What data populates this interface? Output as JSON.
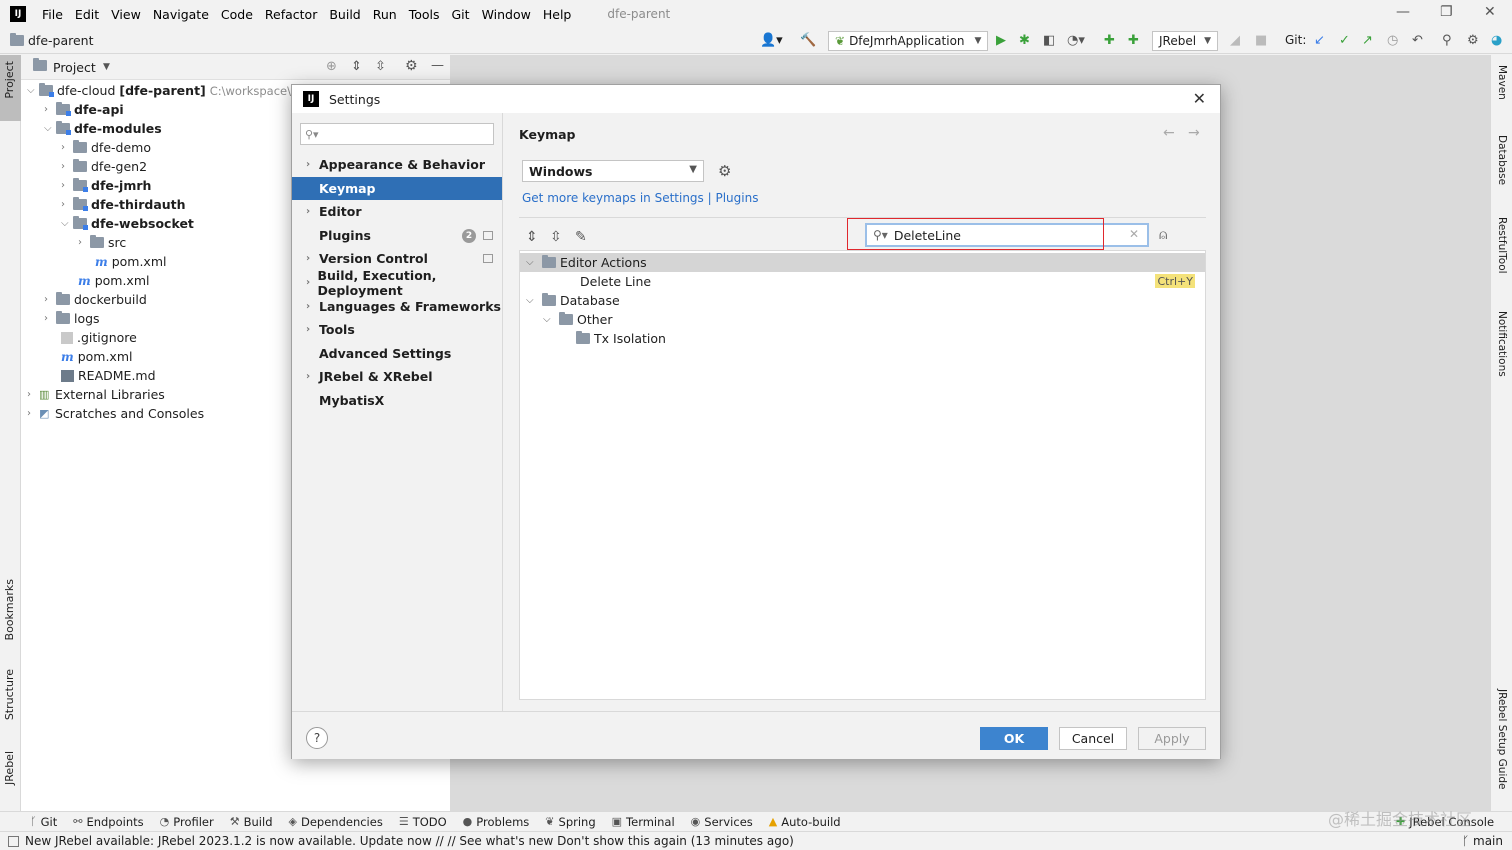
{
  "app": {
    "logo": "IJ",
    "menu": [
      "File",
      "Edit",
      "View",
      "Navigate",
      "Code",
      "Refactor",
      "Build",
      "Run",
      "Tools",
      "Git",
      "Window",
      "Help"
    ],
    "window_title": "dfe-parent"
  },
  "toolbar": {
    "project_name": "dfe-parent",
    "run_config": "DfeJmrhApplication",
    "jrebel_select": "JRebel",
    "git_label": "Git:"
  },
  "project_panel": {
    "title": "Project",
    "tree": [
      {
        "label": "dfe-cloud",
        "suffix": "[dfe-parent]",
        "path": "C:\\workspace\\dfe"
      },
      {
        "label": "dfe-api"
      },
      {
        "label": "dfe-modules"
      },
      {
        "label": "dfe-demo"
      },
      {
        "label": "dfe-gen2"
      },
      {
        "label": "dfe-jmrh"
      },
      {
        "label": "dfe-thirdauth"
      },
      {
        "label": "dfe-websocket"
      },
      {
        "label": "src"
      },
      {
        "label": "pom.xml"
      },
      {
        "label": "pom.xml"
      },
      {
        "label": "dockerbuild"
      },
      {
        "label": "logs"
      },
      {
        "label": ".gitignore"
      },
      {
        "label": "pom.xml"
      },
      {
        "label": "README.md"
      },
      {
        "label": "External Libraries"
      },
      {
        "label": "Scratches and Consoles"
      }
    ]
  },
  "left_tabs": {
    "project": "Project",
    "bookmarks": "Bookmarks",
    "structure": "Structure",
    "jrebel": "JRebel"
  },
  "right_tabs": {
    "maven": "Maven",
    "database": "Database",
    "restful": "RestfulTool",
    "notifications": "Notifications",
    "jrebel_guide": "JRebel Setup Guide"
  },
  "dialog": {
    "title": "Settings",
    "nav": [
      {
        "label": "Appearance & Behavior",
        "expandable": true
      },
      {
        "label": "Keymap",
        "expandable": false,
        "selected": true
      },
      {
        "label": "Editor",
        "expandable": true
      },
      {
        "label": "Plugins",
        "expandable": false,
        "badge": "2"
      },
      {
        "label": "Version Control",
        "expandable": true
      },
      {
        "label": "Build, Execution, Deployment",
        "expandable": true
      },
      {
        "label": "Languages & Frameworks",
        "expandable": true
      },
      {
        "label": "Tools",
        "expandable": true
      },
      {
        "label": "Advanced Settings",
        "expandable": false
      },
      {
        "label": "JRebel & XRebel",
        "expandable": true
      },
      {
        "label": "MybatisX",
        "expandable": false
      }
    ],
    "keymap": {
      "heading": "Keymap",
      "selected_keymap": "Windows",
      "link": "Get more keymaps in Settings | Plugins",
      "filter_value": "DeleteLine",
      "tree": [
        {
          "label": "Editor Actions",
          "level": 0,
          "expanded": true,
          "highlighted": true
        },
        {
          "label": "Delete Line",
          "level": 1,
          "shortcut": "Ctrl+Y"
        },
        {
          "label": "Database",
          "level": 0,
          "expanded": true
        },
        {
          "label": "Other",
          "level": 1,
          "expanded": true
        },
        {
          "label": "Tx Isolation",
          "level": 2
        }
      ]
    },
    "buttons": {
      "ok": "OK",
      "cancel": "Cancel",
      "apply": "Apply",
      "help": "?"
    }
  },
  "bottom_tools": [
    "Git",
    "Endpoints",
    "Profiler",
    "Build",
    "Dependencies",
    "TODO",
    "Problems",
    "Spring",
    "Terminal",
    "Services",
    "Auto-build",
    "JRebel Console"
  ],
  "status": {
    "message": "New JRebel available: JRebel 2023.1.2 is now available. Update now // // See what's new    Don't show this again (13 minutes ago)",
    "branch": "main"
  },
  "watermark": "@稀土掘金技术社区",
  "colors": {
    "selection": "#2f6fb5",
    "ok_button": "#3d84cf",
    "highlight_box": "#e0282e",
    "shortcut_bg": "#f4e27a",
    "link": "#2a6fc9"
  }
}
